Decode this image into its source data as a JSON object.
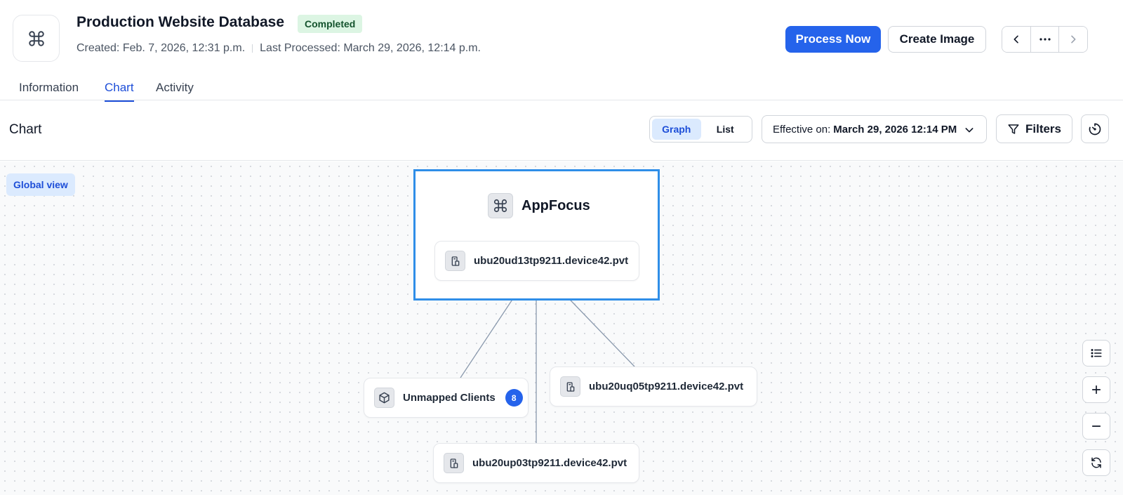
{
  "header": {
    "title": "Production Website Database",
    "status": "Completed",
    "created": "Created: Feb. 7, 2026, 12:31 p.m.",
    "last_processed": "Last Processed: March 29, 2026, 12:14 p.m.",
    "process_now_label": "Process Now",
    "create_image_label": "Create Image",
    "more_label": "···"
  },
  "tabs": [
    {
      "label": "Information",
      "active": false
    },
    {
      "label": "Chart",
      "active": true
    },
    {
      "label": "Activity",
      "active": false
    }
  ],
  "toolbar": {
    "title": "Chart",
    "view_toggle": {
      "graph": "Graph",
      "list": "List",
      "selected": "Graph"
    },
    "effective_label": "Effective on:",
    "effective_value": "March 29, 2026 12:14 PM",
    "filters_label": "Filters"
  },
  "canvas": {
    "global_view_label": "Global view",
    "focus": {
      "name": "AppFocus",
      "device": "ubu20ud13tp9211.device42.pvt"
    },
    "nodes": {
      "unmapped": {
        "label": "Unmapped Clients",
        "count": "8"
      },
      "right": {
        "label": "ubu20uq05tp9211.device42.pvt"
      },
      "bottom": {
        "label": "ubu20up03tp9211.device42.pvt"
      }
    }
  },
  "colors": {
    "primary": "#2563eb",
    "focus_border": "#2f8ee8",
    "status_bg": "#dcf5e3",
    "edge": "#8a99ad"
  }
}
